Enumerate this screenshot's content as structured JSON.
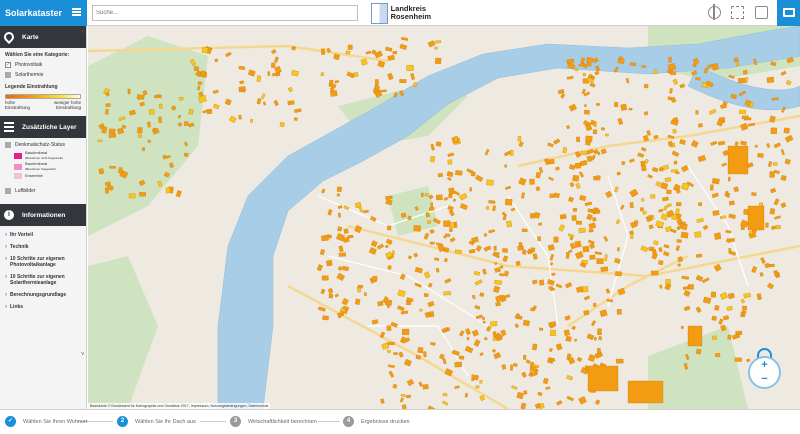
{
  "header": {
    "app_title": "Solarkataster",
    "search_placeholder": "Suche...",
    "logo_line1": "Landkreis",
    "logo_line2": "Rosenheim"
  },
  "sidebar": {
    "karte": {
      "title": "Karte",
      "category_label": "Wählen Sie eine Kategorie:",
      "options": [
        {
          "label": "Photovoltaik",
          "checked": true
        },
        {
          "label": "Solarthermie",
          "checked": false
        }
      ],
      "legend_title": "Legende Einstrahlung",
      "legend_left": "hohe Einstrahlung",
      "legend_right": "weniger hohe Einstrahlung"
    },
    "layers": {
      "title": "Zusätzliche Layer",
      "denkmal_label": "Denkmalschutz-Status",
      "swatches": [
        {
          "label": "Baudenkmal",
          "sub": "(Bewohnen nicht freigestellt)",
          "color": "#e91e8c"
        },
        {
          "label": "Baudenkmal",
          "sub": "(Bewohnen freigestellt)",
          "color": "#f48fc4"
        },
        {
          "label": "Ensemble",
          "sub": "",
          "color": "#f7c1cf"
        }
      ],
      "luftbilder_label": "Luftbilder"
    },
    "info": {
      "title": "Informationen",
      "links": [
        "Ihr Vorteil",
        "Technik",
        "10 Schritte zur eigenen Photovoltaikanlage",
        "10 Schritte zur eigenen Solarthermieanlage",
        "Berechnungsgrundlage",
        "Links"
      ]
    }
  },
  "map": {
    "attribution": "Basiskarte © Bundesamt für Kartographie und Geodäsie 2017, Impressum, Nutzungsbedingungen, Datenschutz",
    "zoom_in": "+",
    "zoom_out": "−"
  },
  "stepper": {
    "steps": [
      {
        "num": "✓",
        "label": "Wählen Sie Ihren Wohnort"
      },
      {
        "num": "2",
        "label": "Wählen Sie Ihr Dach aus"
      },
      {
        "num": "3",
        "label": "Wirtschaftlichkeit berechnen"
      },
      {
        "num": "4",
        "label": "Ergebnisse drucken"
      }
    ]
  },
  "colors": {
    "accent": "#1a8fd8",
    "sidebar_header": "#33363c",
    "water": "#a8cde6",
    "park": "#cfe3c0",
    "roof_high": "#f39c12",
    "roof_mid": "#f7c61d"
  }
}
